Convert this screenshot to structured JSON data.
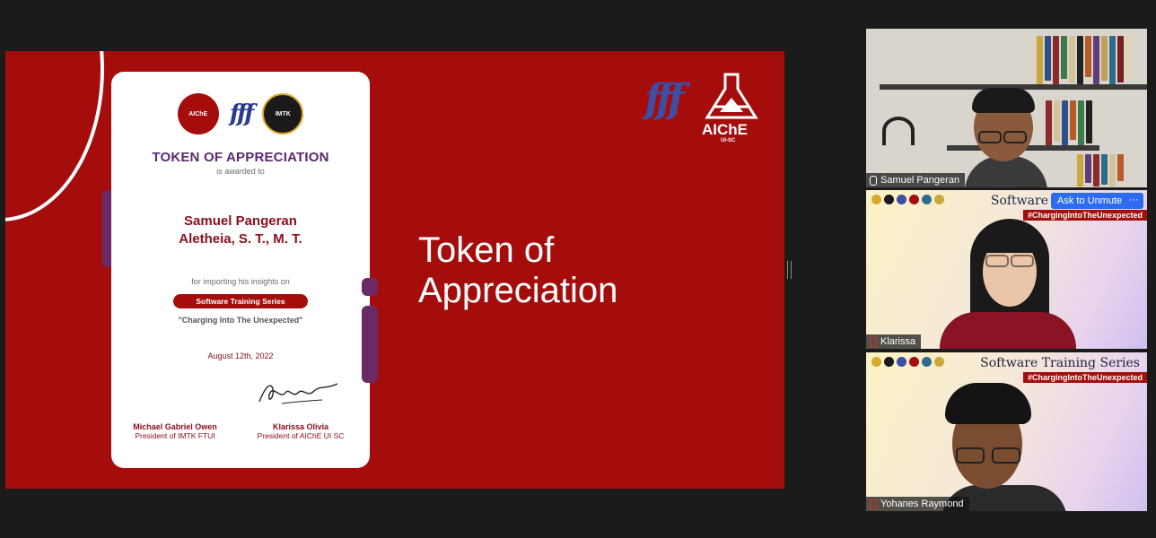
{
  "certificate": {
    "logos": [
      "AIChE",
      "fff",
      "IMTK"
    ],
    "title": "TOKEN OF APPRECIATION",
    "subtitle": "is awarded to",
    "recipient_line1": "Samuel Pangeran",
    "recipient_line2": "Aletheia, S. T., M. T.",
    "for_text": "for importing his insights on",
    "event_pill": "Software Training Series",
    "quote": "\"Charging Into The Unexpected\"",
    "date": "August 12th, 2022",
    "signatories": [
      {
        "name": "Michael Gabriel Owen",
        "role": "President of IMTK FTUI"
      },
      {
        "name": "Klarissa Olivia",
        "role": "President of AIChE UI SC"
      }
    ]
  },
  "slide": {
    "title_line1": "Token of",
    "title_line2": "Appreciation",
    "brand_script": "fff",
    "brand_name": "AIChE",
    "brand_sub": "UI-SC"
  },
  "participants": [
    {
      "name": "Samuel Pangeran",
      "muted": false
    },
    {
      "name": "Klarissa",
      "muted": true,
      "banner": "Software",
      "hashtag": "#ChargingIntoTheUnexpected",
      "ask_label": "Ask to Unmute",
      "more_label": "···"
    },
    {
      "name": "Yohanes Raymond",
      "muted": true,
      "banner": "Software Training Series",
      "hashtag": "#ChargingIntoTheUnexpected"
    }
  ],
  "colors": {
    "brand_red": "#a50d0d",
    "purple": "#5a2a6e",
    "zoom_blue": "#2d6cf0"
  }
}
